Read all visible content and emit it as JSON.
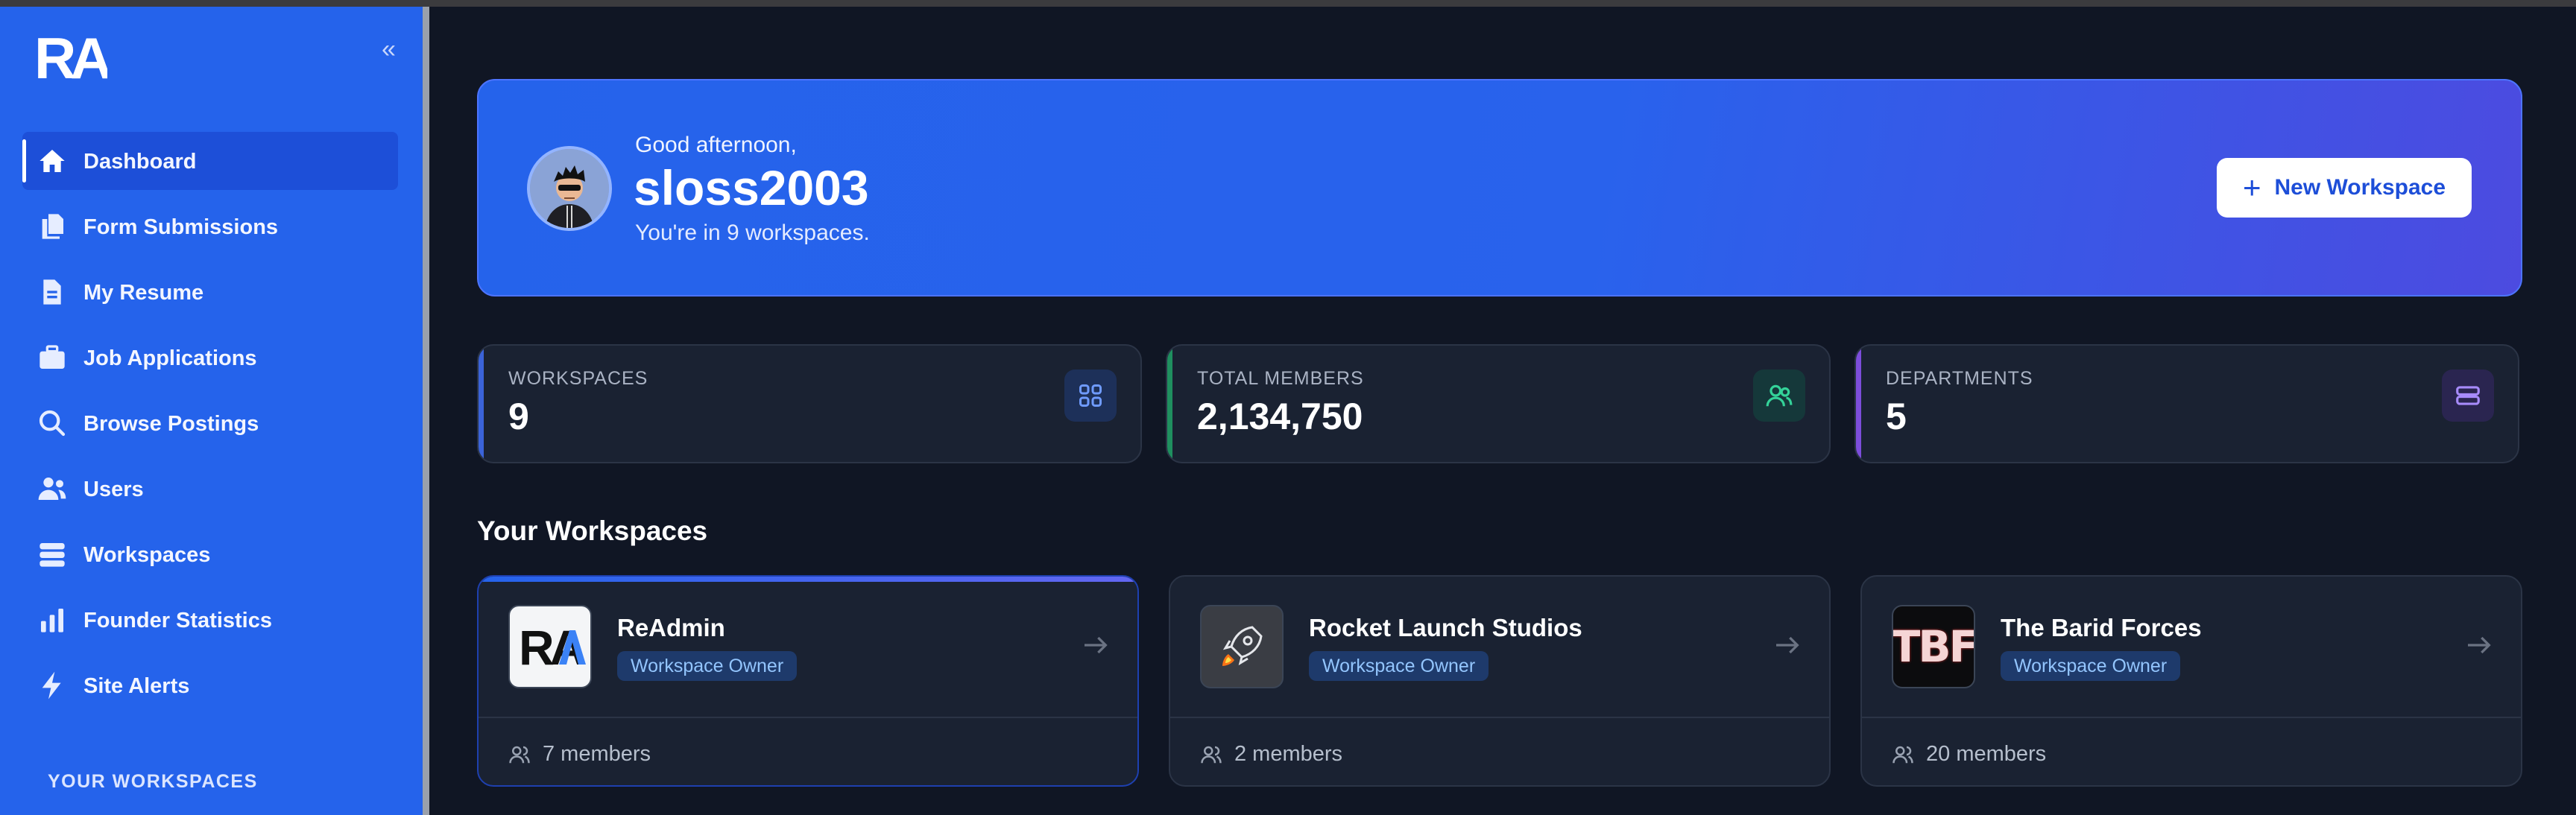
{
  "sidebar": {
    "logo_text": "RA",
    "collapse_glyph": "«",
    "items": [
      {
        "label": "Dashboard",
        "icon": "home-icon",
        "active": true
      },
      {
        "label": "Form Submissions",
        "icon": "documents-icon"
      },
      {
        "label": "My Resume",
        "icon": "file-icon"
      },
      {
        "label": "Job Applications",
        "icon": "briefcase-icon"
      },
      {
        "label": "Browse Postings",
        "icon": "search-icon"
      },
      {
        "label": "Users",
        "icon": "users-icon"
      },
      {
        "label": "Workspaces",
        "icon": "database-icon"
      },
      {
        "label": "Founder Statistics",
        "icon": "bar-chart-icon"
      },
      {
        "label": "Site Alerts",
        "icon": "bolt-icon"
      }
    ],
    "section_label": "YOUR WORKSPACES"
  },
  "hero": {
    "greeting": "Good afternoon,",
    "username": "sloss2003",
    "workspace_count_text": "You're in 9 workspaces.",
    "new_workspace_label": "New Workspace"
  },
  "stats": [
    {
      "label": "WORKSPACES",
      "value": "9",
      "accent": "#3b63d8",
      "icon": "grid-icon"
    },
    {
      "label": "TOTAL MEMBERS",
      "value": "2,134,750",
      "accent": "#1f8f5f",
      "icon": "users-icon"
    },
    {
      "label": "DEPARTMENTS",
      "value": "5",
      "accent": "#7c4ddb",
      "icon": "database-icon"
    }
  ],
  "workspaces_section_title": "Your Workspaces",
  "workspaces": [
    {
      "name": "ReAdmin",
      "role": "Workspace Owner",
      "members": "7 members",
      "logo_text": "RA"
    },
    {
      "name": "Rocket Launch Studios",
      "role": "Workspace Owner",
      "members": "2 members",
      "logo_text": ""
    },
    {
      "name": "The Barid Forces",
      "role": "Workspace Owner",
      "members": "20 members",
      "logo_text": "TBF"
    }
  ],
  "colors": {
    "sidebar": "#2563eb",
    "background": "#101624",
    "card": "#1a2232",
    "badge_text": "#93c5fd"
  }
}
